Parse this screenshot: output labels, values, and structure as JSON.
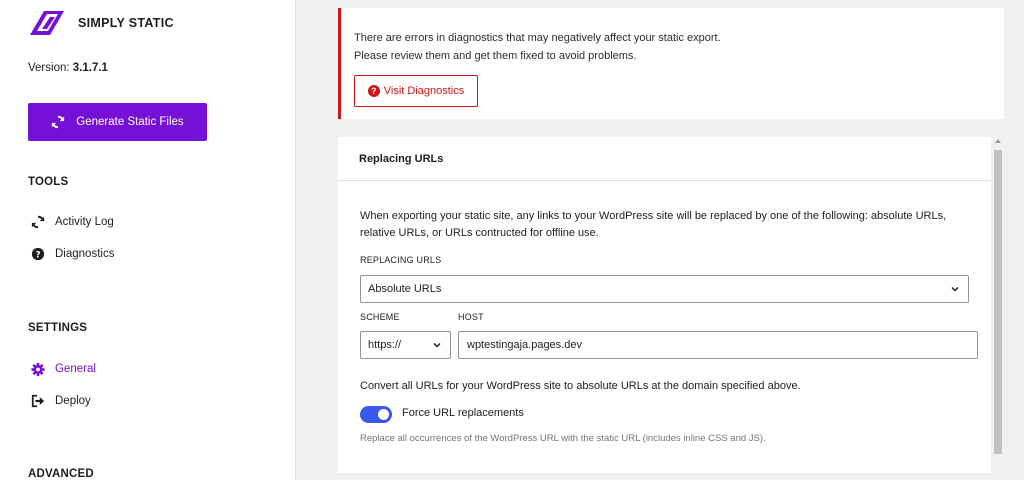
{
  "app": {
    "brand": "SIMPLY STATIC",
    "version_label": "Version:",
    "version_value": "3.1.7.1",
    "accent_color": "#7510d6"
  },
  "sidebar": {
    "generate_button": "Generate Static Files",
    "sections": {
      "tools": "TOOLS",
      "settings": "SETTINGS",
      "advanced": "ADVANCED"
    },
    "tools_items": [
      {
        "label": "Activity Log",
        "icon": "sync-icon"
      },
      {
        "label": "Diagnostics",
        "icon": "help-circle-icon"
      }
    ],
    "settings_items": [
      {
        "label": "General",
        "icon": "gear-icon",
        "active": true
      },
      {
        "label": "Deploy",
        "icon": "exit-icon",
        "active": false
      }
    ]
  },
  "notice": {
    "line1": "There are errors in diagnostics that may negatively affect your static export.",
    "line2": "Please review them and get them fixed to avoid problems.",
    "button": "Visit Diagnostics",
    "color": "#cc1818"
  },
  "replacing_urls": {
    "title": "Replacing URLs",
    "description": "When exporting your static site, any links to your WordPress site will be replaced by one of the following: absolute URLs, relative URLs, or URLs contructed for offline use.",
    "select_label": "REPLACING URLS",
    "select_value": "Absolute URLs",
    "scheme_label": "SCHEME",
    "scheme_value": "https://",
    "host_label": "HOST",
    "host_value": "wptestingaja.pages.dev",
    "convert_note": "Convert all URLs for your WordPress site to absolute URLs at the domain specified above.",
    "toggle_label": "Force URL replacements",
    "toggle_on": true,
    "toggle_color": "#3858e9",
    "help_text": "Replace all occurrences of the WordPress URL with the static URL (includes inline CSS and JS)."
  }
}
